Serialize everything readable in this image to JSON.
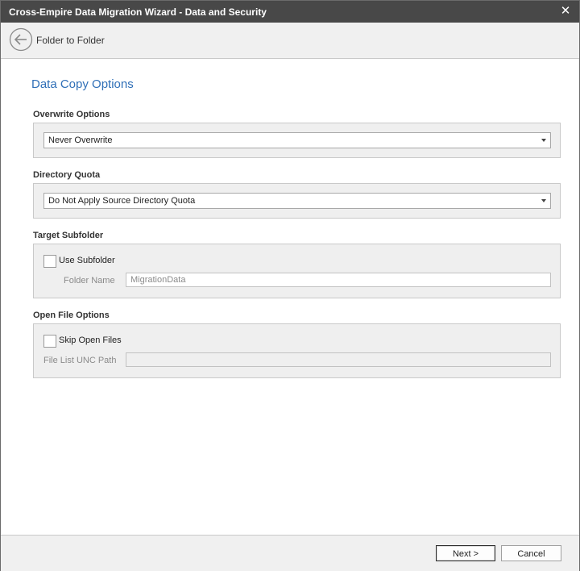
{
  "window": {
    "title": "Cross-Empire Data Migration Wizard  -  Data and Security",
    "close_label": "✕"
  },
  "nav": {
    "back_icon": "back-arrow-icon",
    "title": "Folder to Folder"
  },
  "page": {
    "title": "Data Copy Options"
  },
  "overwrite": {
    "label": "Overwrite Options",
    "value": "Never Overwrite"
  },
  "quota": {
    "label": "Directory Quota",
    "value": "Do Not Apply Source Directory Quota"
  },
  "subfolder": {
    "label": "Target Subfolder",
    "checkbox_label": "Use Subfolder",
    "checked": false,
    "folder_name_label": "Folder Name",
    "folder_name_value": "MigrationData"
  },
  "open_file": {
    "label": "Open File Options",
    "checkbox_label": "Skip Open Files",
    "checked": false,
    "unc_label": "File List UNC Path",
    "unc_value": ""
  },
  "footer": {
    "next_label": "Next >",
    "cancel_label": "Cancel"
  },
  "colors": {
    "titlebar": "#484848",
    "accent": "#2f6fb7",
    "group_bg": "#efefef"
  }
}
